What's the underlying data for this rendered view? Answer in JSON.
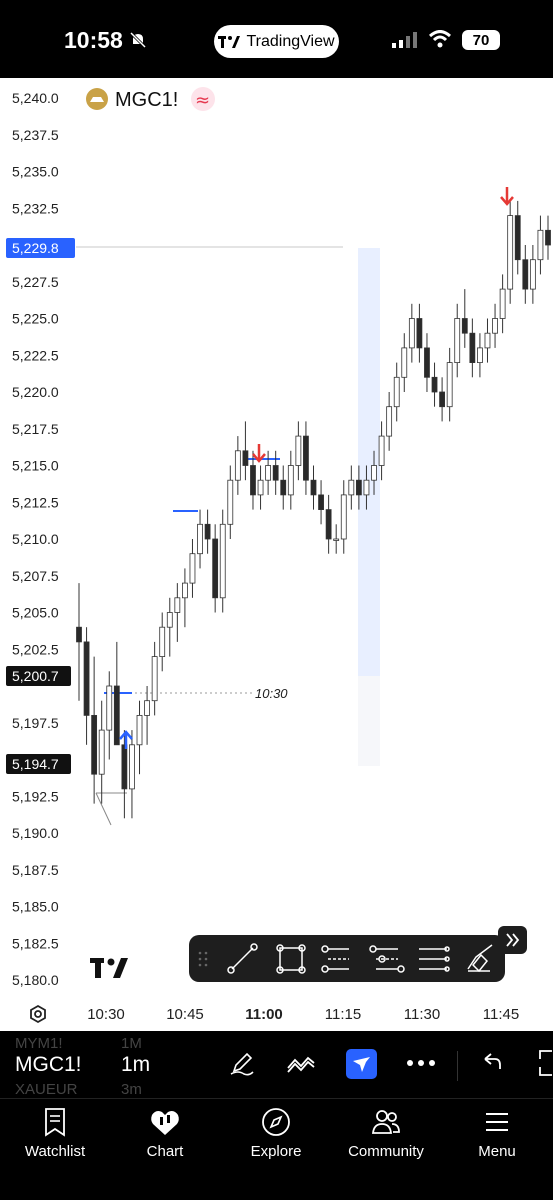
{
  "status": {
    "time": "10:58",
    "app_pill": "TradingView",
    "battery": "70"
  },
  "chart_header": {
    "symbol": "MGC1!"
  },
  "price_axis": {
    "ticks": [
      "5,240.0",
      "5,237.5",
      "5,235.0",
      "5,232.5",
      "5,227.5",
      "5,225.0",
      "5,222.5",
      "5,220.0",
      "5,217.5",
      "5,215.0",
      "5,212.5",
      "5,210.0",
      "5,207.5",
      "5,205.0",
      "5,202.5",
      "5,197.5",
      "5,192.5",
      "5,190.0",
      "5,187.5",
      "5,185.0",
      "5,182.5",
      "5,180.0"
    ],
    "current_price_label": "5,229.8",
    "marker_high": "5,200.7",
    "marker_low": "5,194.7"
  },
  "time_axis": {
    "ticks": [
      "10:30",
      "10:45",
      "11:00",
      "11:15",
      "11:30",
      "11:45"
    ],
    "bold_tick": "11:00"
  },
  "annotation": {
    "label": "10:30"
  },
  "chart_data": {
    "type": "candlestick",
    "ohlc": [
      [
        5204,
        5207,
        5199,
        5203
      ],
      [
        5203,
        5204,
        5196,
        5198
      ],
      [
        5198,
        5202,
        5192,
        5194
      ],
      [
        5194,
        5199,
        5192,
        5197
      ],
      [
        5197,
        5201,
        5195,
        5200
      ],
      [
        5200,
        5203,
        5196,
        5196
      ],
      [
        5196,
        5197,
        5191,
        5193
      ],
      [
        5193,
        5197,
        5191,
        5196
      ],
      [
        5196,
        5199,
        5194,
        5198
      ],
      [
        5198,
        5200,
        5196,
        5199
      ],
      [
        5199,
        5203,
        5198,
        5202
      ],
      [
        5202,
        5205,
        5201,
        5204
      ],
      [
        5204,
        5206,
        5202,
        5205
      ],
      [
        5205,
        5207,
        5203,
        5206
      ],
      [
        5206,
        5208,
        5204,
        5207
      ],
      [
        5207,
        5210,
        5206,
        5209
      ],
      [
        5209,
        5212,
        5208,
        5211
      ],
      [
        5211,
        5212,
        5209,
        5210
      ],
      [
        5210,
        5211,
        5205,
        5206
      ],
      [
        5206,
        5212,
        5205,
        5211
      ],
      [
        5211,
        5215,
        5210,
        5214
      ],
      [
        5214,
        5217,
        5213,
        5216
      ],
      [
        5216,
        5218,
        5214,
        5215
      ],
      [
        5215,
        5216,
        5212,
        5213
      ],
      [
        5213,
        5215,
        5212,
        5214
      ],
      [
        5214,
        5216,
        5213,
        5215
      ],
      [
        5215,
        5216,
        5213,
        5214
      ],
      [
        5214,
        5215,
        5212,
        5213
      ],
      [
        5213,
        5216,
        5212,
        5215
      ],
      [
        5215,
        5218,
        5214,
        5217
      ],
      [
        5217,
        5218,
        5213,
        5214
      ],
      [
        5214,
        5215,
        5212,
        5213
      ],
      [
        5213,
        5214,
        5211,
        5212
      ],
      [
        5212,
        5213,
        5209,
        5210
      ],
      [
        5210,
        5211,
        5209,
        5210
      ],
      [
        5210,
        5214,
        5209,
        5213
      ],
      [
        5213,
        5215,
        5212,
        5214
      ],
      [
        5214,
        5215,
        5212,
        5213
      ],
      [
        5213,
        5215,
        5212,
        5214
      ],
      [
        5214,
        5216,
        5213,
        5215
      ],
      [
        5215,
        5218,
        5214,
        5217
      ],
      [
        5217,
        5220,
        5216,
        5219
      ],
      [
        5219,
        5222,
        5218,
        5221
      ],
      [
        5221,
        5224,
        5220,
        5223
      ],
      [
        5223,
        5226,
        5222,
        5225
      ],
      [
        5225,
        5226,
        5222,
        5223
      ],
      [
        5223,
        5224,
        5220,
        5221
      ],
      [
        5221,
        5222,
        5219,
        5220
      ],
      [
        5220,
        5221,
        5218,
        5219
      ],
      [
        5219,
        5223,
        5218,
        5222
      ],
      [
        5222,
        5226,
        5221,
        5225
      ],
      [
        5225,
        5227,
        5223,
        5224
      ],
      [
        5224,
        5225,
        5221,
        5222
      ],
      [
        5222,
        5224,
        5221,
        5223
      ],
      [
        5223,
        5225,
        5222,
        5224
      ],
      [
        5224,
        5226,
        5223,
        5225
      ],
      [
        5225,
        5228,
        5224,
        5227
      ],
      [
        5227,
        5233,
        5226,
        5232
      ],
      [
        5232,
        5233,
        5228,
        5229
      ],
      [
        5229,
        5230,
        5226,
        5227
      ],
      [
        5227,
        5230,
        5226,
        5229
      ],
      [
        5229,
        5232,
        5228,
        5231
      ],
      [
        5231,
        5232,
        5229,
        5230
      ]
    ],
    "y_range": [
      5180.0,
      5240.0
    ],
    "x_ticks": [
      "10:30",
      "10:45",
      "11:00",
      "11:15",
      "11:30",
      "11:45"
    ]
  },
  "drawing_toolbar": {
    "items": [
      "drag-handle",
      "trend-line",
      "rectangle",
      "parallel-channel",
      "regression",
      "horizontal-lines",
      "brush"
    ]
  },
  "bottom": {
    "ghost_rows": [
      {
        "symbol": "MYM1!",
        "tf": "1M"
      },
      {
        "symbol": "XAUEUR",
        "tf": "3m"
      }
    ],
    "symbol": "MGC1!",
    "timeframe": "1m"
  },
  "nav": {
    "items": [
      {
        "label": "Watchlist"
      },
      {
        "label": "Chart"
      },
      {
        "label": "Explore"
      },
      {
        "label": "Community"
      },
      {
        "label": "Menu"
      }
    ]
  },
  "colors": {
    "up": "#ffffff",
    "down": "#2a2a2a",
    "accent": "#2962ff",
    "arrow_down": "#e53935",
    "arrow_up": "#2962ff"
  }
}
